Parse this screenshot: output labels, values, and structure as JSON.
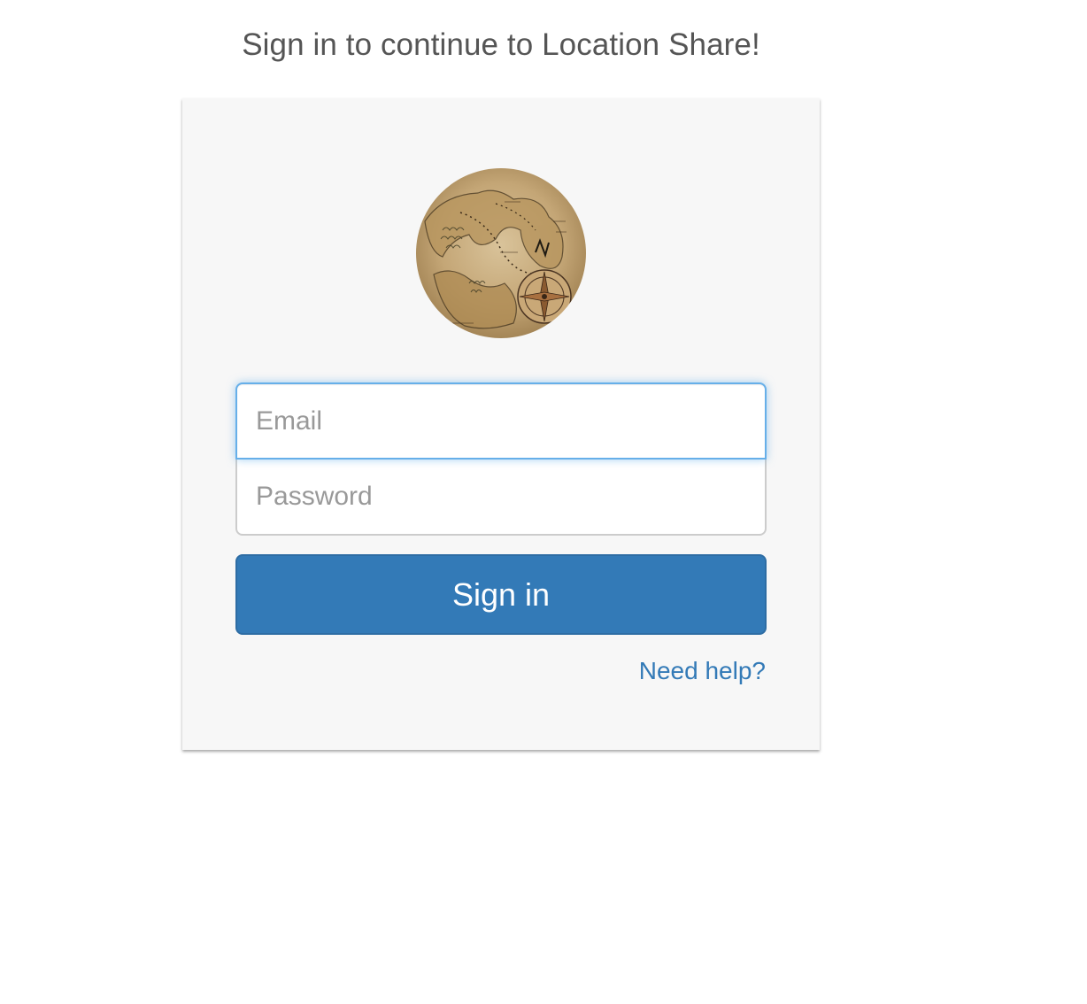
{
  "page": {
    "heading": "Sign in to continue to Location Share!"
  },
  "login": {
    "avatar_icon": "treasure-map-image",
    "email_placeholder": "Email",
    "email_value": "",
    "password_placeholder": "Password",
    "password_value": "",
    "signin_label": "Sign in",
    "help_link": "Need help?"
  },
  "colors": {
    "primary": "#337ab7",
    "focus_border": "#66afe9",
    "card_background": "#f7f7f7",
    "heading_text": "#555555"
  }
}
